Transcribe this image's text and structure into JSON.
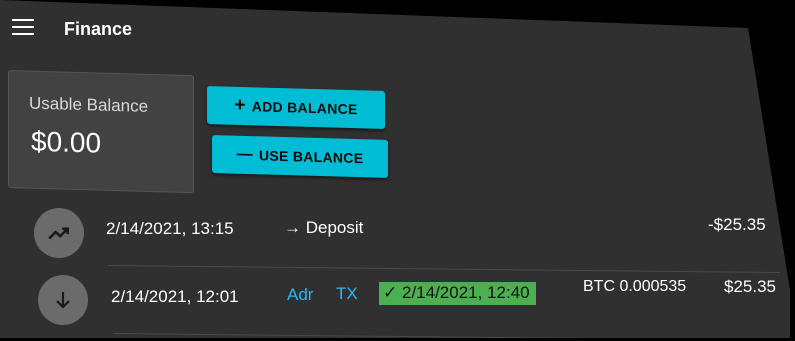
{
  "header": {
    "title": "Finance"
  },
  "balance": {
    "label": "Usable Balance",
    "value": "$0.00"
  },
  "actions": {
    "add_label": "ADD BALANCE",
    "add_glyph": "+",
    "use_label": "USE BALANCE",
    "use_glyph": "—"
  },
  "transactions": [
    {
      "icon": "trending-up-icon",
      "datetime": "2/14/2021, 13:15",
      "type_arrow": "→",
      "type_label": "Deposit",
      "amount": "-$25.35"
    },
    {
      "icon": "arrow-down-icon",
      "datetime": "2/14/2021, 12:01",
      "address_link": "Adr",
      "tx_link": "TX",
      "status_check": "✓",
      "status_datetime": "2/14/2021, 12:40",
      "crypto_amount": "BTC 0.000535",
      "amount": "$25.35"
    }
  ],
  "colors": {
    "accent": "#00bcd4",
    "link": "#29b6f6",
    "success": "#4caf50",
    "background": "#303030",
    "card": "#424242"
  }
}
